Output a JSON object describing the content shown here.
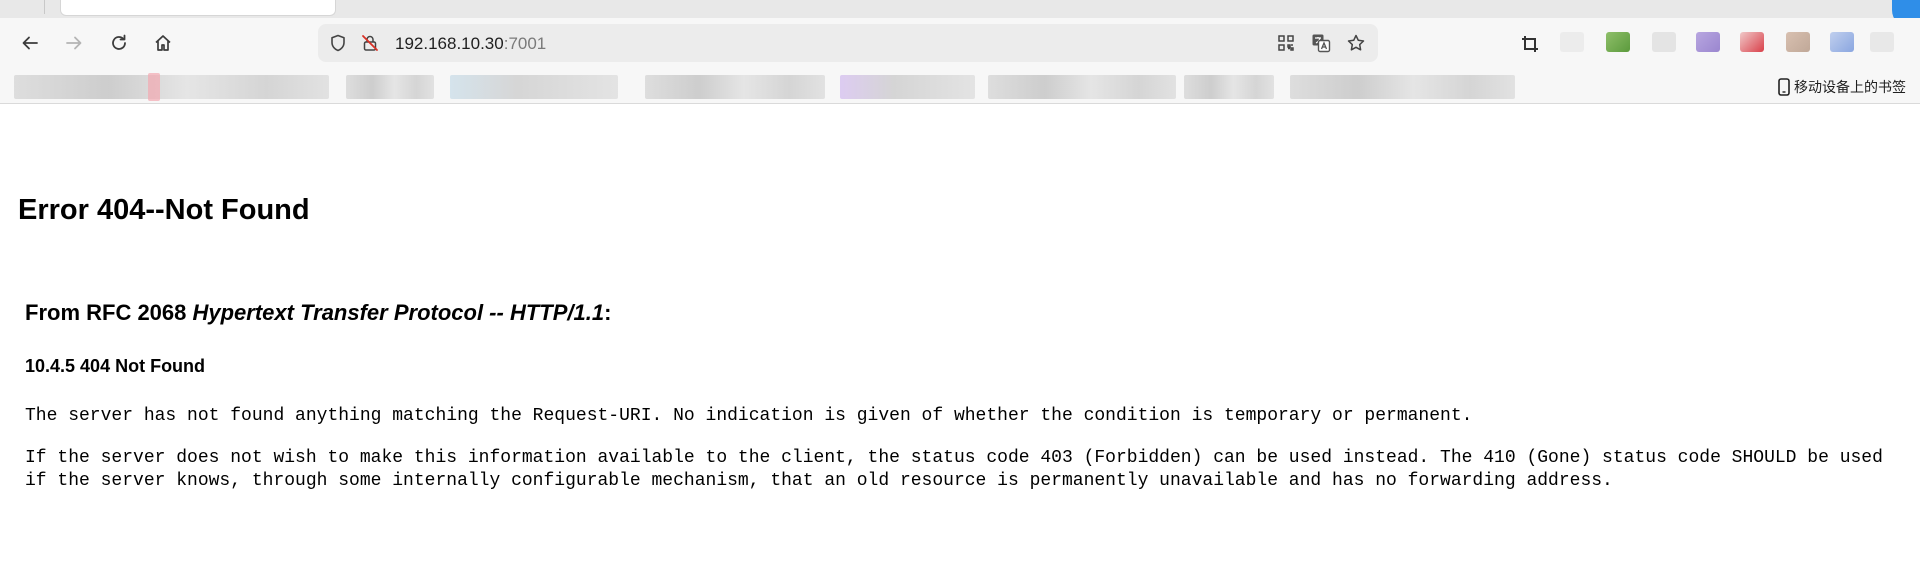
{
  "browser": {
    "address_bar": {
      "host": "192.168.10.30",
      "port": ":7001"
    },
    "bookmarks_bar": {
      "mobile_bookmarks_label": "移动设备上的书签"
    },
    "icons": {
      "back": "arrow-left-icon",
      "forward": "arrow-right-icon",
      "reload": "reload-icon",
      "home": "home-icon",
      "tracking_protection": "shield-icon",
      "connection_insecure": "lock-slash-icon",
      "qr_code": "qr-code-icon",
      "translate": "translate-icon",
      "bookmark_star": "star-icon",
      "screenshot_crop": "crop-icon",
      "mobile_device": "phone-icon"
    },
    "colors": {
      "toolbar_bg": "#f7f7f7",
      "omnibox_bg": "#ececec",
      "port_text": "#7a7a7a",
      "profile_avatar": "#2f8ee8"
    }
  },
  "page": {
    "title": "Error 404--Not Found",
    "rfc_heading_prefix": "From RFC 2068 ",
    "rfc_heading_italic": "Hypertext Transfer Protocol -- HTTP/1.1",
    "rfc_heading_suffix": ":",
    "section_heading": "10.4.5 404 Not Found",
    "paragraph_1": "The server has not found anything matching the Request-URI. No indication is given of whether the condition is temporary or permanent.",
    "paragraph_2": "If the server does not wish to make this information available to the client, the status code 403 (Forbidden) can be used instead. The 410 (Gone) status code SHOULD be used if the server knows, through some internally configurable mechanism, that an old resource is permanently unavailable and has no forwarding address."
  }
}
